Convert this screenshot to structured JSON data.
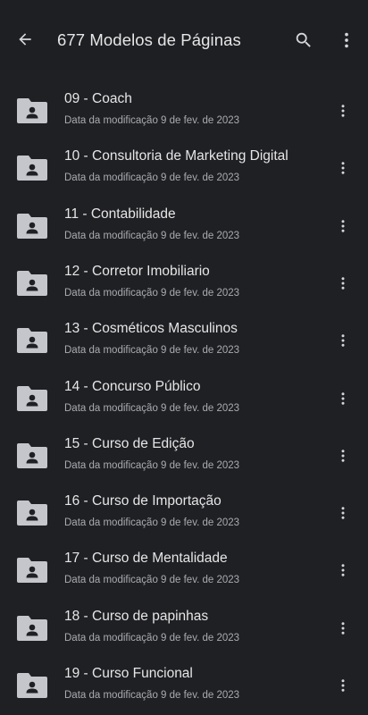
{
  "header": {
    "title": "677 Modelos de Páginas",
    "back_icon": "arrow-back-icon",
    "search_icon": "search-icon",
    "more_icon": "more-vert-icon"
  },
  "colors": {
    "background": "#1f2024",
    "text_primary": "#e6e6e6",
    "text_secondary": "#a9abb0",
    "icon": "#c4c6cc"
  },
  "files": [
    {
      "name": "09 - Coach",
      "modified": "Data da modificação 9 de fev. de 2023",
      "icon": "shared-folder-icon"
    },
    {
      "name": "10 - Consultoria de Marketing Digital",
      "modified": "Data da modificação 9 de fev. de 2023",
      "icon": "shared-folder-icon"
    },
    {
      "name": "11 - Contabilidade",
      "modified": "Data da modificação 9 de fev. de 2023",
      "icon": "shared-folder-icon"
    },
    {
      "name": "12 - Corretor Imobiliario",
      "modified": "Data da modificação 9 de fev. de 2023",
      "icon": "shared-folder-icon"
    },
    {
      "name": "13 - Cosméticos Masculinos",
      "modified": "Data da modificação 9 de fev. de 2023",
      "icon": "shared-folder-icon"
    },
    {
      "name": "14 - Concurso Público",
      "modified": "Data da modificação 9 de fev. de 2023",
      "icon": "shared-folder-icon"
    },
    {
      "name": "15 - Curso de Edição",
      "modified": "Data da modificação 9 de fev. de 2023",
      "icon": "shared-folder-icon"
    },
    {
      "name": "16 - Curso de Importação",
      "modified": "Data da modificação 9 de fev. de 2023",
      "icon": "shared-folder-icon"
    },
    {
      "name": "17 - Curso de Mentalidade",
      "modified": "Data da modificação 9 de fev. de 2023",
      "icon": "shared-folder-icon"
    },
    {
      "name": "18 - Curso de papinhas",
      "modified": "Data da modificação 9 de fev. de 2023",
      "icon": "shared-folder-icon"
    },
    {
      "name": "19 - Curso Funcional",
      "modified": "Data da modificação 9 de fev. de 2023",
      "icon": "shared-folder-icon"
    }
  ]
}
